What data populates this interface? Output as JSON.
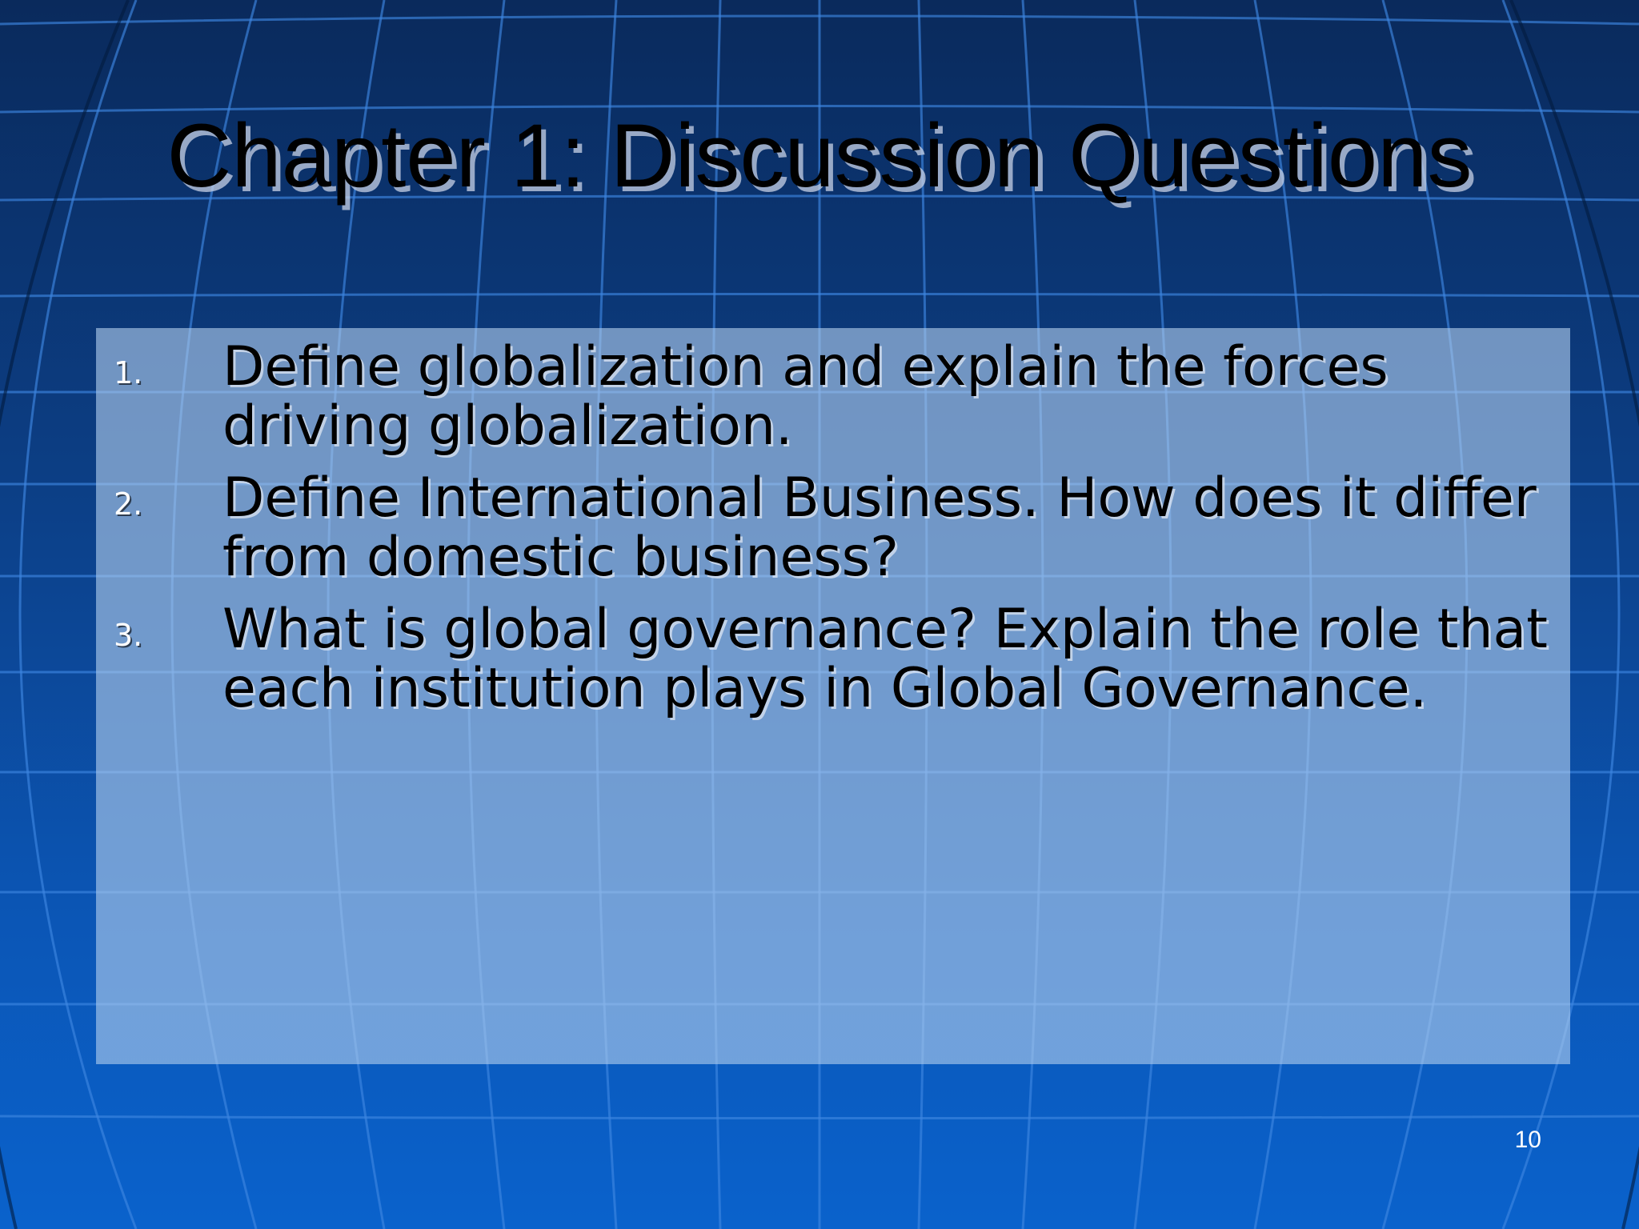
{
  "slide": {
    "title": "Chapter 1: Discussion Questions",
    "questions": [
      {
        "number": "1.",
        "line1": "Define globalization and explain the forces",
        "line2": "driving globalization."
      },
      {
        "number": "2.",
        "line1": "Define International Business. How does it differ",
        "line2": "from domestic business?"
      },
      {
        "number": "3.",
        "line1": "What is global governance? Explain the role that",
        "line2": "each institution plays in Global Governance."
      }
    ],
    "page_number": "10"
  },
  "colors": {
    "background_top": "#0a2a5c",
    "background_bottom": "#0a62cc",
    "grid_line": "#3d86e0",
    "panel": "#b0cdee",
    "text": "#000000"
  }
}
